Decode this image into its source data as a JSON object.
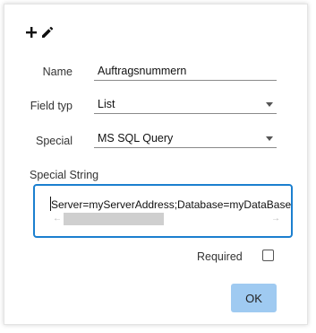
{
  "header": {
    "icons": [
      "plus-icon",
      "pencil-icon"
    ]
  },
  "form": {
    "name": {
      "label": "Name",
      "value": "Auftragsnummern"
    },
    "field_type": {
      "label": "Field typ",
      "value": "List"
    },
    "special": {
      "label": "Special",
      "value": "MS SQL Query"
    },
    "special_string": {
      "label": "Special String",
      "value": "Server=myServerAddress;Database=myDataBase"
    },
    "required": {
      "label": "Required",
      "checked": false
    }
  },
  "actions": {
    "ok_label": "OK"
  },
  "colors": {
    "accent_border": "#1b7fcf",
    "ok_button": "#9fcaf1"
  }
}
